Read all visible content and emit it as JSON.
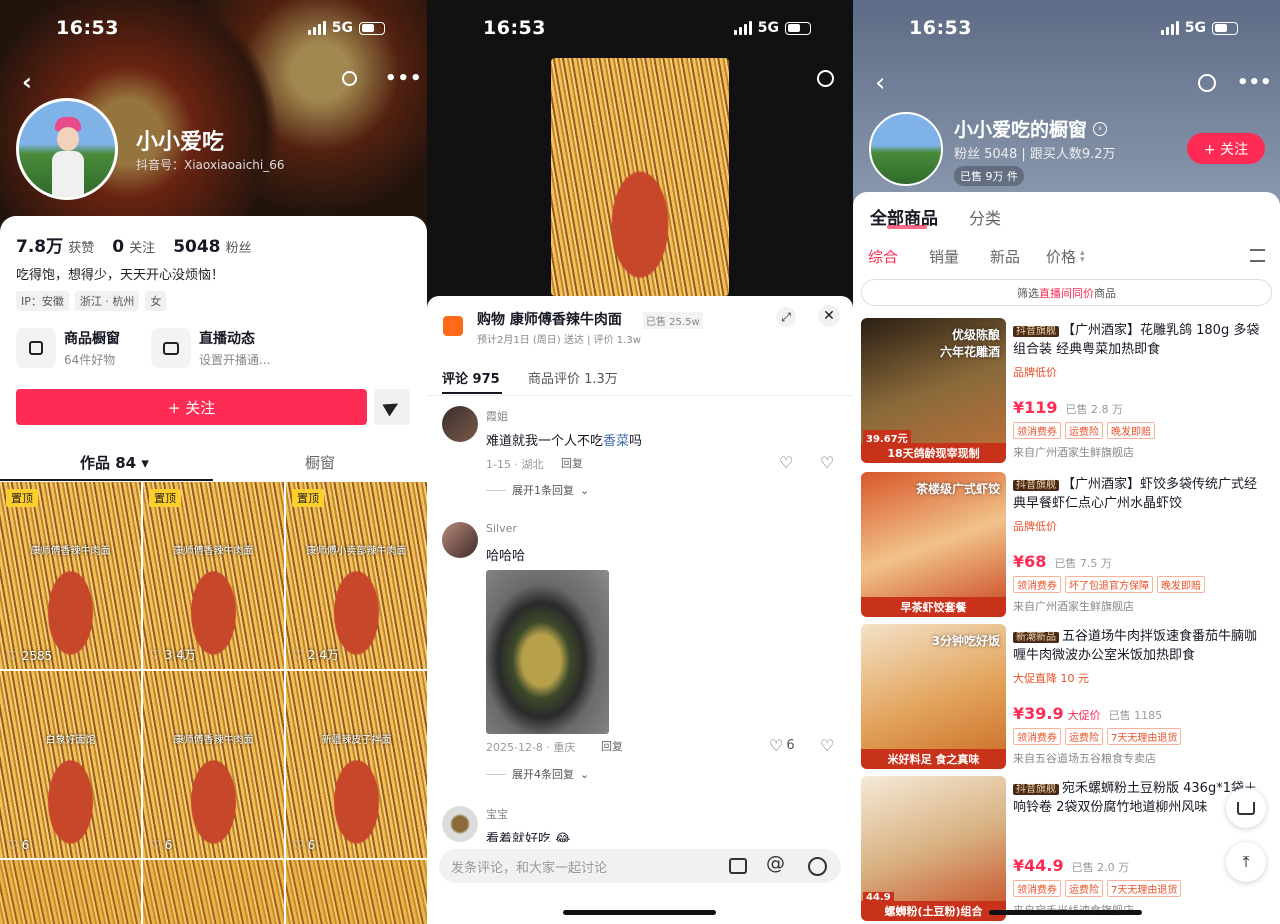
{
  "status_bar": {
    "time": "16:53",
    "network": "5G"
  },
  "profile": {
    "name": "小小爱吃",
    "douyin_id": "抖音号：Xiaoxiaoaichi_66",
    "stats": [
      {
        "value": "7.8万",
        "label": "获赞"
      },
      {
        "value": "0",
        "label": "关注"
      },
      {
        "value": "5048",
        "label": "粉丝"
      }
    ],
    "bio": "吃得饱，想得少，天天开心没烦恼！",
    "tags": [
      "IP：安徽",
      "浙江 · 杭州",
      "女"
    ],
    "features": [
      {
        "title": "商品橱窗",
        "sub": "64件好物",
        "icon": "shop-window-icon"
      },
      {
        "title": "直播动态",
        "sub": "设置开播通...",
        "icon": "live-tv-icon"
      }
    ],
    "follow_label": "+ 关注",
    "tabs": [
      "作品 84 ▾",
      "橱窗"
    ],
    "videos": [
      {
        "pinned": "置顶",
        "likes": "2585",
        "caption": "康师傅香辣牛肉面"
      },
      {
        "pinned": "置顶",
        "likes": "3.4万",
        "caption": "康师傅香辣牛肉面"
      },
      {
        "pinned": "置顶",
        "likes": "2.4万",
        "caption": "康师傅小卖部辣牛肉面"
      },
      {
        "pinned": "",
        "likes": "6",
        "caption": "白象好面馆"
      },
      {
        "pinned": "",
        "likes": "6",
        "caption": "康师傅香辣牛肉面"
      },
      {
        "pinned": "",
        "likes": "6",
        "caption": "新疆辣皮子拌面"
      }
    ]
  },
  "comments_panel": {
    "product_title": "购物  康师傅香辣牛肉面",
    "sold": "已售 25.5w",
    "delivery": "预计2月1日 (周日) 送达 | 评价 1.3w",
    "tabs": [
      "评论 975",
      "商品评价 1.3万"
    ],
    "comments": [
      {
        "user": "霞姐",
        "text_before": "难道就我一个人不吃",
        "link": "香菜",
        "text_after": "吗",
        "meta": "1-15 · 湖北",
        "reply": "回复",
        "likes": "",
        "expand": "展开1条回复"
      },
      {
        "user": "Silver",
        "text_before": "哈哈哈",
        "link": "",
        "text_after": "",
        "meta": "2025-12-8 · 重庆",
        "reply": "回复",
        "likes": "6",
        "expand": "展开4条回复"
      },
      {
        "user": "宝宝",
        "text_before": "看着就好吃",
        "link": "",
        "text_after": "",
        "meta": "",
        "reply": "",
        "likes": "",
        "expand": ""
      }
    ],
    "input_placeholder": "发条评论，和大家一起讨论"
  },
  "shop": {
    "title": "小小爱吃的橱窗",
    "fans": "粉丝 5048",
    "buyers": "跟买人数9.2万",
    "sold": "已售 9万 件",
    "follow_label": "+ 关注",
    "main_tabs": [
      "全部商品",
      "分类"
    ],
    "sort_tabs": [
      "综合",
      "销量",
      "新品",
      "价格"
    ],
    "filter_prefix": "筛选",
    "filter_highlight": "直播间同价",
    "filter_suffix": "商品",
    "products": [
      {
        "store_badge": "抖音旗舰",
        "name": "【广州酒家】花雕乳鸽 180g 多袋组合装 经典粤菜加热即食",
        "promo_text": "品牌低价",
        "price": "¥119",
        "sold": "已售 2.8 万",
        "tags": [
          "领消费券",
          "运费险",
          "晚发即赔"
        ],
        "store": "来自广州酒家生鲜旗舰店",
        "img_top": "优级陈酿\n六年花雕酒",
        "img_bottom": "18天鸽龄现宰现制",
        "img_price": "39.67元"
      },
      {
        "store_badge": "抖音旗舰",
        "name": "【广州酒家】虾饺多袋传统广式经典早餐虾仁点心广州水晶虾饺",
        "promo_text": "品牌低价",
        "price": "¥68",
        "sold": "已售 7.5 万",
        "tags": [
          "领消费券",
          "坏了包退官方保障",
          "晚发即赔"
        ],
        "store": "来自广州酒家生鲜旗舰店",
        "img_top": "茶楼级广式虾饺",
        "img_bottom": "早茶虾饺套餐",
        "img_price": ""
      },
      {
        "store_badge": "新潮新品",
        "name": "五谷道场牛肉拌饭速食番茄牛腩咖喱牛肉微波办公室米饭加热即食",
        "promo_text": "大促直降 10 元",
        "price": "¥39.9",
        "price_suffix": "大促价",
        "sold": "已售 1185",
        "tags": [
          "领消费券",
          "运费险",
          "7天无理由退货"
        ],
        "store": "来自五谷道场五谷粮食专卖店",
        "img_top": "3分钟吃好饭",
        "img_bottom": "米好料足 食之真味",
        "img_price": ""
      },
      {
        "store_badge": "抖音旗舰",
        "name": "宛禾螺蛳粉土豆粉版 436g*1袋＋响铃卷 2袋双份腐竹地道柳州风味",
        "promo_text": "",
        "price": "¥44.9",
        "sold": "已售 2.0 万",
        "tags": [
          "领消费券",
          "运费险",
          "7天无理由退货"
        ],
        "store": "来自宛禾米线速食旗舰店",
        "img_top": "",
        "img_bottom": "螺蛳粉(土豆粉)组合",
        "img_price": "44.9"
      }
    ]
  },
  "colors": {
    "accent": "#fe2c55",
    "orange": "#ff5a00",
    "tag": "#f25c26"
  }
}
